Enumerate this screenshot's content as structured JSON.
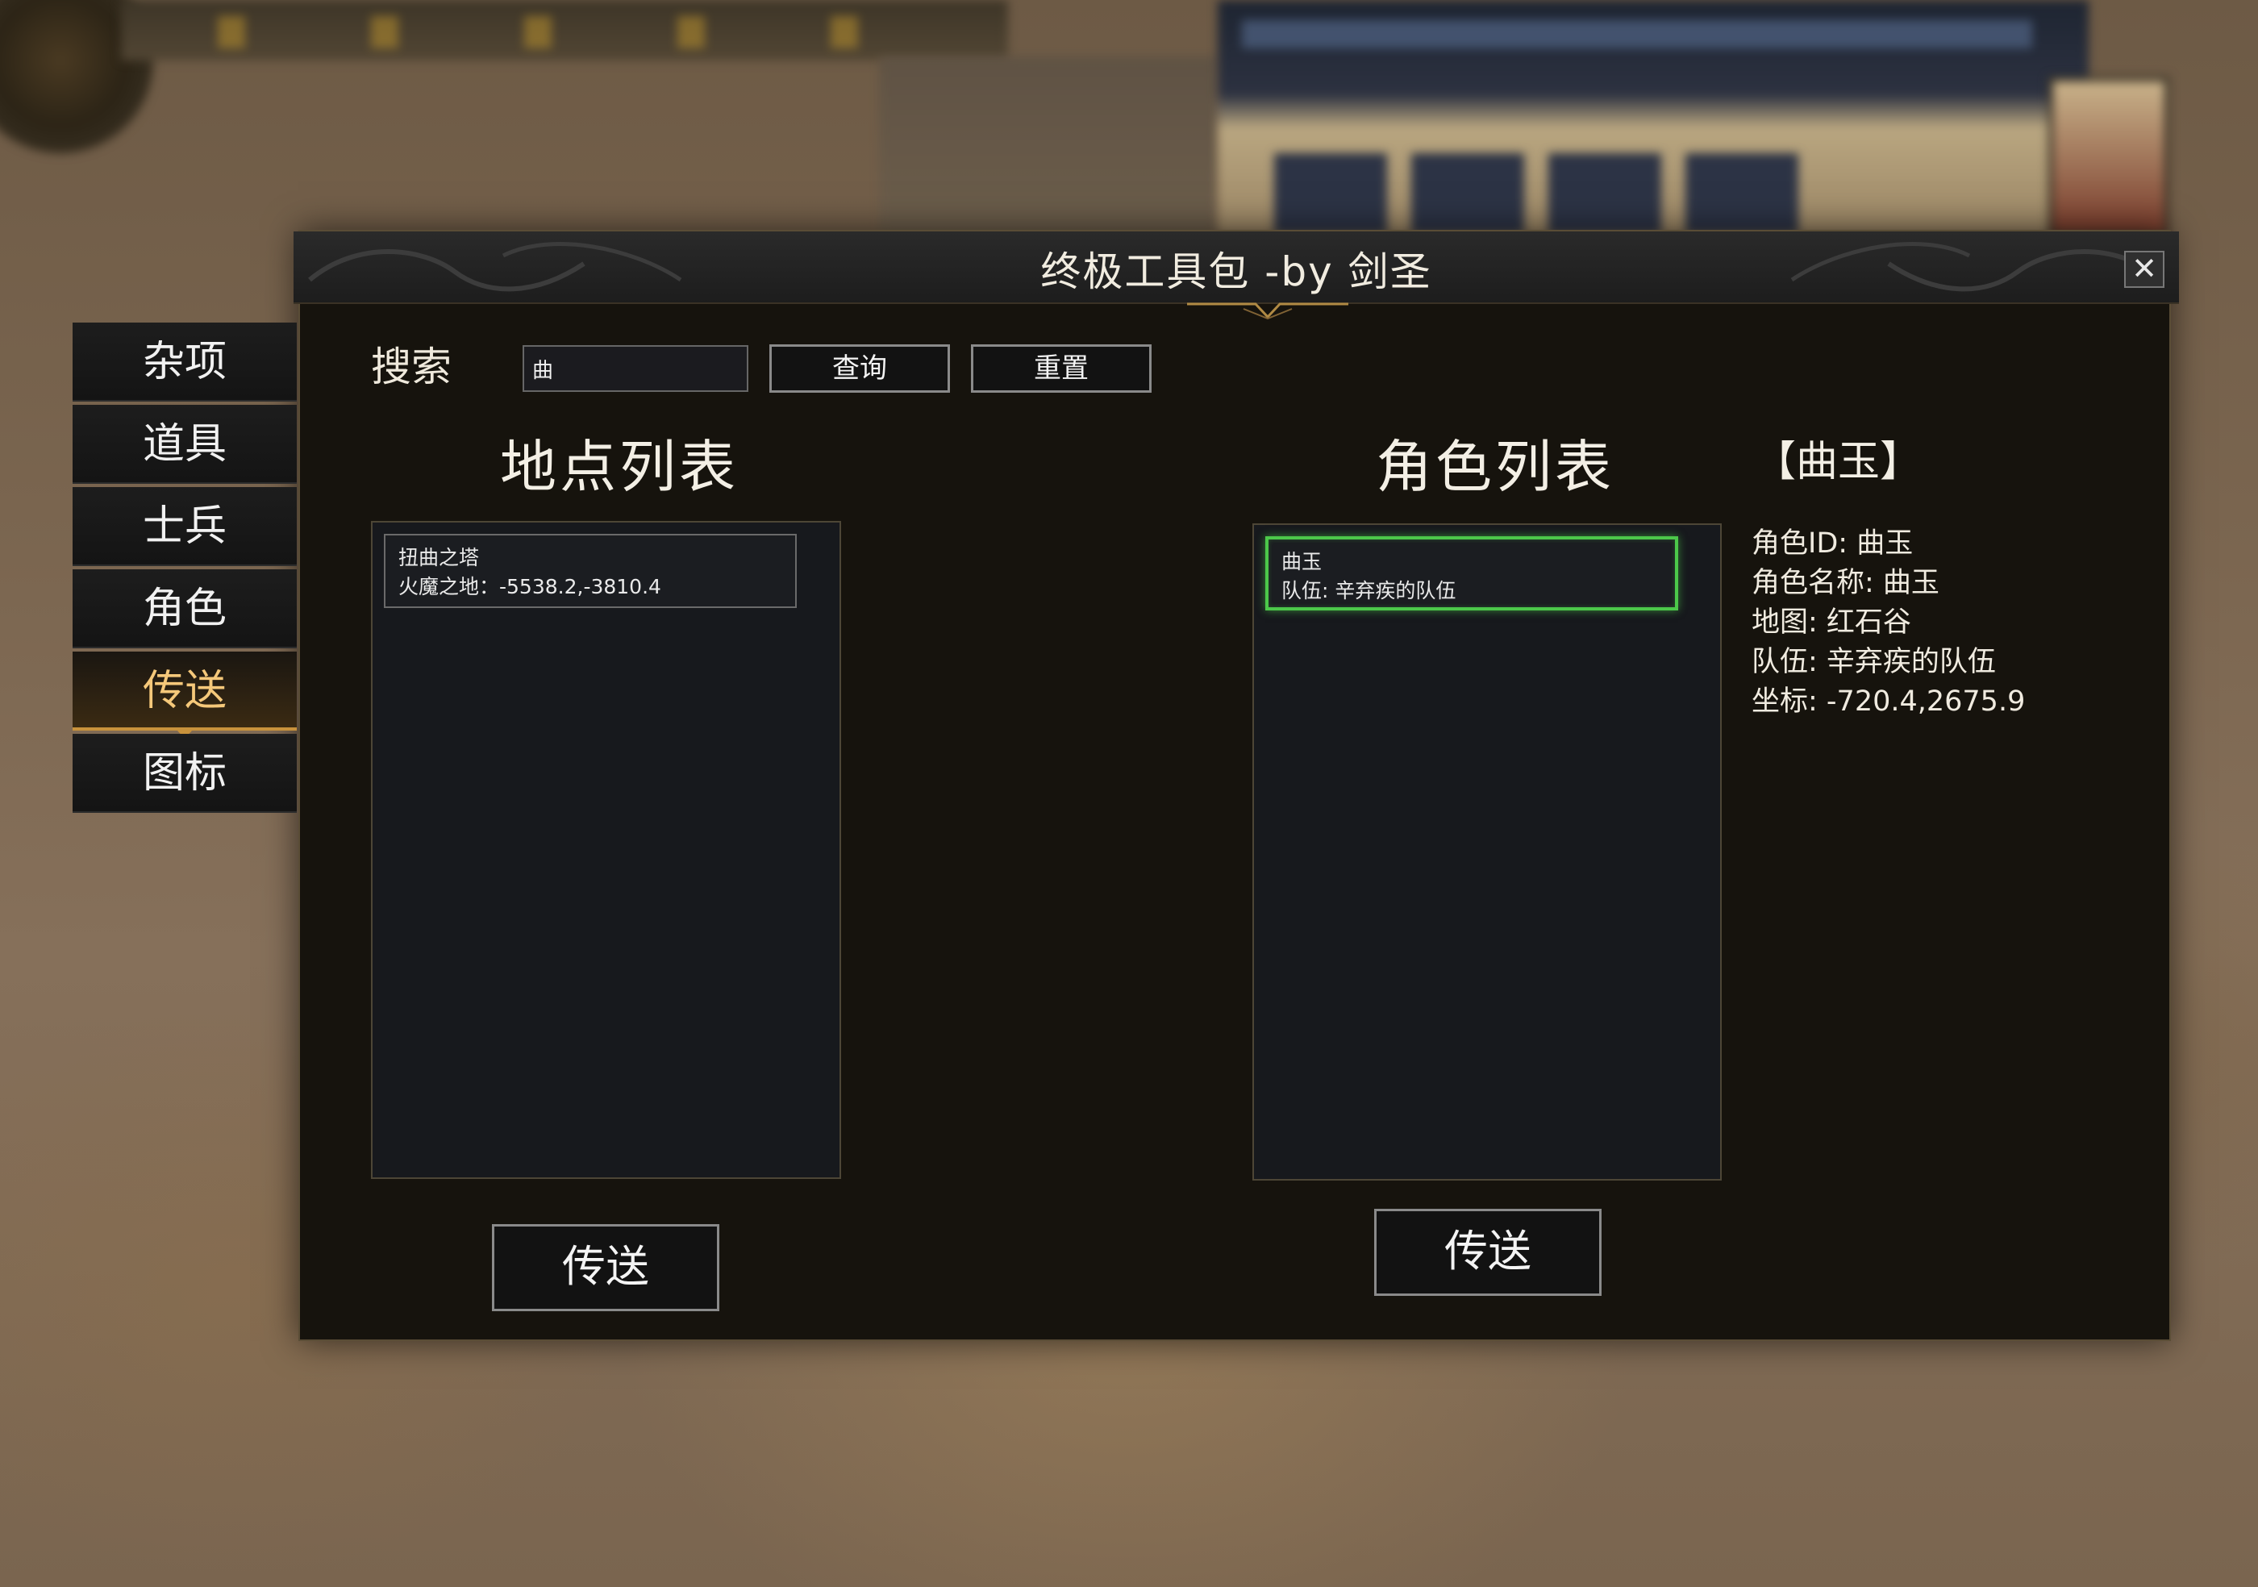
{
  "window": {
    "title": "终极工具包 -by 剑圣",
    "close_icon": "close-icon"
  },
  "sidebar": {
    "items": [
      {
        "label": "杂项",
        "active": false
      },
      {
        "label": "道具",
        "active": false
      },
      {
        "label": "士兵",
        "active": false
      },
      {
        "label": "角色",
        "active": false
      },
      {
        "label": "传送",
        "active": true
      },
      {
        "label": "图标",
        "active": false
      }
    ]
  },
  "search": {
    "label": "搜索",
    "value": "曲",
    "query_label": "查询",
    "reset_label": "重置"
  },
  "locations": {
    "title": "地点列表",
    "items": [
      {
        "name": "扭曲之塔",
        "detail": "火魔之地：-5538.2,-3810.4"
      }
    ],
    "teleport_label": "传送"
  },
  "characters": {
    "title": "角色列表",
    "items": [
      {
        "name": "曲玉",
        "detail": "队伍: 辛弃疾的队伍",
        "selected": true
      }
    ],
    "teleport_label": "传送"
  },
  "selected_character": {
    "heading": "【曲玉】",
    "details": [
      "角色ID: 曲玉",
      "角色名称: 曲玉",
      "地图: 红石谷",
      "队伍: 辛弃疾的队伍",
      "坐标: -720.4,2675.9"
    ]
  },
  "colors": {
    "accent_active_tab": "#c8923c",
    "selected_border": "#4cc84a",
    "window_bg": "#16130d"
  }
}
